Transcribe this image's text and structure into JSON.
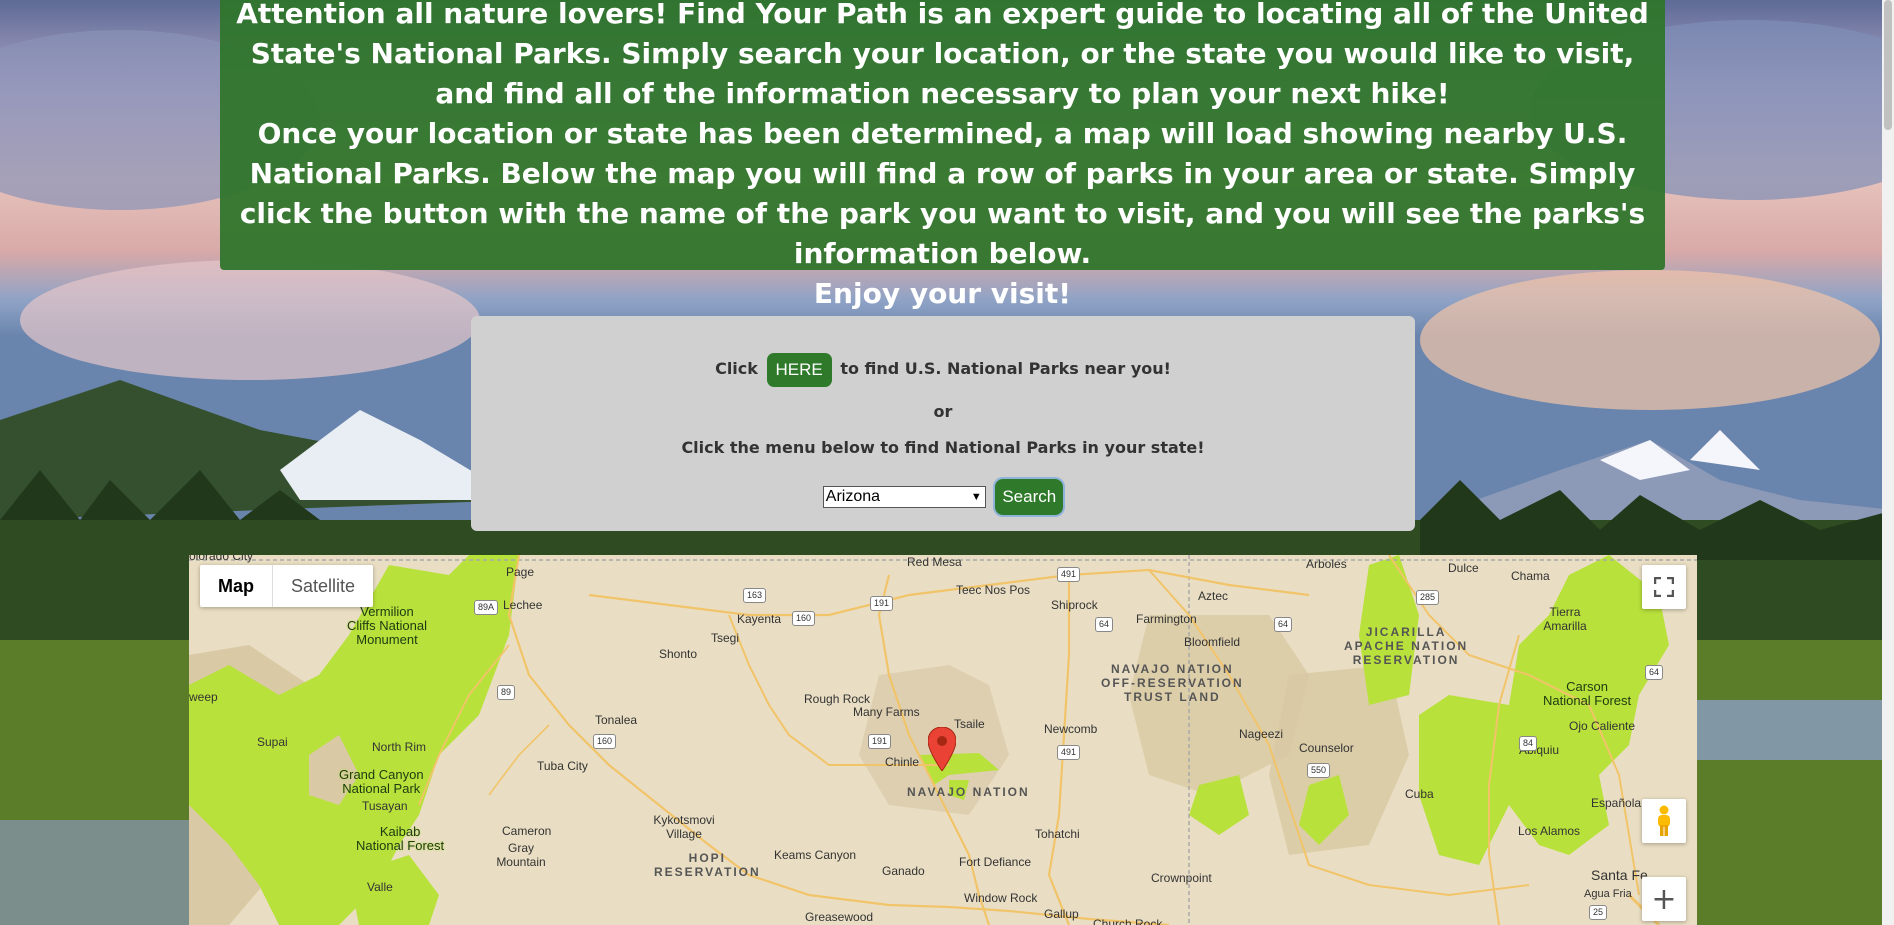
{
  "intro": {
    "paragraph1": "Attention all nature lovers! Find Your Path is an expert guide to locating all of the United State's National Parks. Simply search your location, or the state you would like to visit, and find all of the information necessary to plan your next hike!",
    "paragraph2": "Once your location or state has been determined, a map will load showing nearby U.S. National Parks. Below the map you will find a row of parks in your area or state. Simply click the button with the name of the park you want to visit, and you will see the parks's information below.",
    "paragraph3": "Enjoy your visit!"
  },
  "search_panel": {
    "click_prefix": "Click",
    "here_button": "HERE",
    "click_suffix": "to find U.S. National Parks near you!",
    "or_text": "or",
    "menu_text": "Click the menu below to find National Parks in your state!",
    "state_selected": "Arizona",
    "search_button": "Search"
  },
  "map": {
    "map_type_map": "Map",
    "map_type_satellite": "Satellite",
    "fullscreen_icon": "fullscreen-icon",
    "pegman_icon": "pegman-icon",
    "zoom_in": "+",
    "labels": {
      "colorado_city": "olorado City",
      "page": "Page",
      "red_mesa": "Red Mesa",
      "arboles": "Arboles",
      "dulce": "Dulce",
      "chama": "Chama",
      "lechee": "Lechee",
      "teec_nos_pos": "Teec Nos Pos",
      "shiprock": "Shiprock",
      "aztec": "Aztec",
      "kayenta": "Kayenta",
      "tsegi": "Tsegi",
      "farmington": "Farmington",
      "bloomfield": "Bloomfield",
      "tierra_amarilla": "Tierra Amarilla",
      "shonto": "Shonto",
      "rough_rock": "Rough Rock",
      "many_farms": "Many Farms",
      "tsaile": "Tsaile",
      "newcomb": "Newcomb",
      "tonalea": "Tonalea",
      "north_rim": "North Rim",
      "supai": "Supai",
      "weep": "weep",
      "chinle": "Chinle",
      "nageezi": "Nageezi",
      "counselor": "Counselor",
      "ojo_caliente": "Ojo Caliente",
      "abiquiu": "Abiquiu",
      "tuba_city": "Tuba City",
      "tusayan": "Tusayan",
      "cameron": "Cameron",
      "gray_mountain": "Gray Mountain",
      "kykotsmovi": "Kykotsmovi Village",
      "keams_canyon": "Keams Canyon",
      "ganado": "Ganado",
      "fort_defiance": "Fort Defiance",
      "tohatchi": "Tohatchi",
      "crownpoint": "Crownpoint",
      "cuba": "Cuba",
      "espanola": "Española",
      "los_alamos": "Los Alamos",
      "santa_fe": "Santa Fe",
      "agua_fria": "Agua Fria",
      "valle": "Valle",
      "window_rock": "Window Rock",
      "gallup": "Gallup",
      "greasewood": "Greasewood",
      "church_rock": "Church Rock"
    },
    "regions": {
      "navajo_nation": "NAVAJO NATION",
      "hopi_line1": "HOPI",
      "hopi_line2": "RESERVATION",
      "navajo_offres_line1": "NAVAJO NATION",
      "navajo_offres_line2": "OFF-RESERVATION",
      "navajo_offres_line3": "TRUST LAND",
      "jicarilla_line1": "JICARILLA",
      "jicarilla_line2": "APACHE NATION",
      "jicarilla_line3": "RESERVATION"
    },
    "parks": {
      "vermilion_line1": "Vermilion",
      "vermilion_line2": "Cliffs National",
      "vermilion_line3": "Monument",
      "grand_canyon_line1": "Grand Canyon",
      "grand_canyon_line2": "National Park",
      "kaibab_line1": "Kaibab",
      "kaibab_line2": "National Forest",
      "carson_line1": "Carson",
      "carson_line2": "National Forest"
    },
    "routes": [
      "89A",
      "163",
      "191",
      "491",
      "160",
      "64",
      "89",
      "160",
      "191",
      "491",
      "550",
      "84",
      "285",
      "64",
      "64",
      "25"
    ]
  },
  "colors": {
    "brand_green": "#2f7a2a",
    "panel_gray": "#d0d0d0",
    "park_green": "#b9e13c",
    "map_bg": "#e8dcc0"
  }
}
